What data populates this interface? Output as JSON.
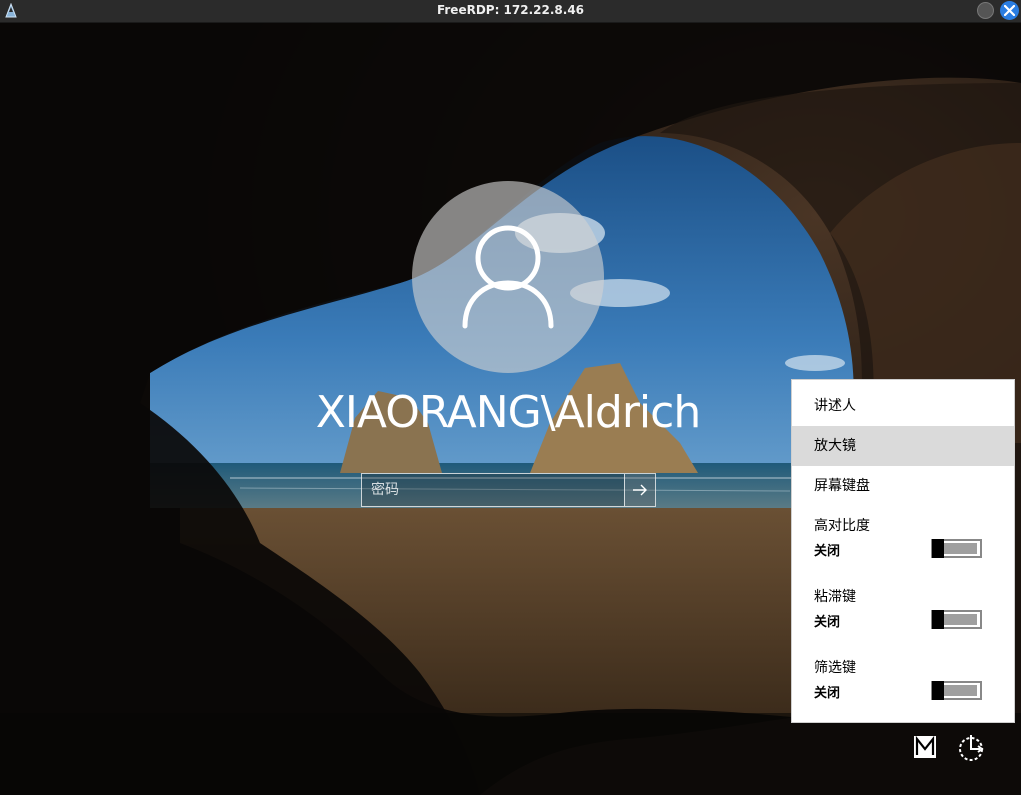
{
  "window": {
    "title": "FreeRDP: 172.22.8.46"
  },
  "login": {
    "username": "XIAORANG\\Aldrich",
    "password_placeholder": "密码",
    "password_value": ""
  },
  "ease_of_access": {
    "items": [
      {
        "label": "讲述人"
      },
      {
        "label": "放大镜",
        "highlighted": true
      },
      {
        "label": "屏幕键盘"
      }
    ],
    "toggles": [
      {
        "label": "高对比度",
        "state": "关闭"
      },
      {
        "label": "粘滞键",
        "state": "关闭"
      },
      {
        "label": "筛选键",
        "state": "关闭"
      }
    ]
  },
  "icons": {
    "avatar": "user-icon",
    "submit": "arrow-right-icon",
    "ime": "input-method-icon",
    "power": "power-icon"
  },
  "colors": {
    "panel_bg": "#ffffff",
    "highlight": "#dadada",
    "title_bar": "#2b2b2b",
    "close_button": "#2a7de1"
  }
}
